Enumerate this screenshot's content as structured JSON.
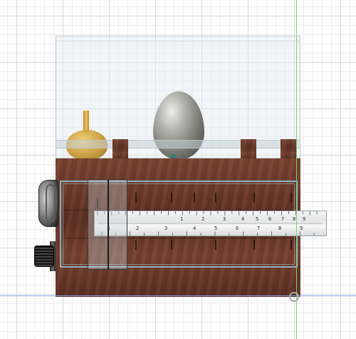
{
  "viewport": {
    "background": "#fdfdfd",
    "grid_color": "#d9d9d9",
    "axis_green": "#79d27f",
    "axis_blue": "#8ea6ef"
  },
  "model": {
    "glass_enclosure": "glass-case",
    "wood_color": "#6b3a2b",
    "rule_labels_top": [
      "1",
      "2",
      "3",
      "4",
      "5",
      "6",
      "7",
      "8",
      "9"
    ],
    "rule_labels_bottom": [
      "1",
      "2",
      "3",
      "4",
      "5",
      "6",
      "7",
      "8",
      "9"
    ]
  },
  "icons": {
    "origin": "origin-marker-icon"
  }
}
